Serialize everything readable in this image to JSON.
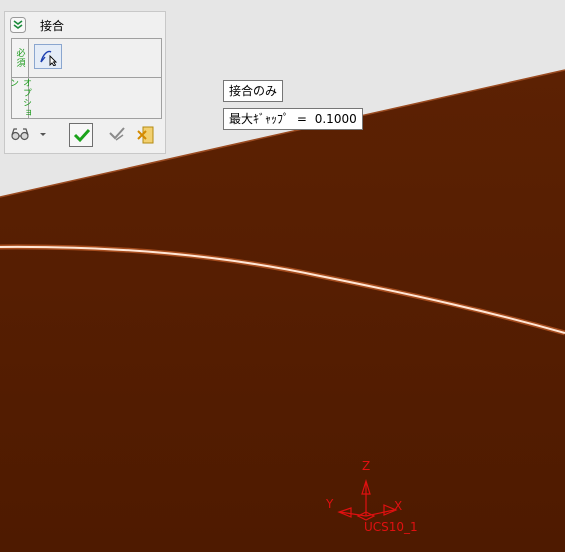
{
  "panel": {
    "title": "接合",
    "required_tab": "必須",
    "options_tab": "オプション"
  },
  "tooltips": {
    "join_only": "接合のみ",
    "max_gap_label": "最大ｷﾞｬｯﾌﾟ",
    "max_gap_equals": "=",
    "max_gap_value": "0.1000"
  },
  "triad": {
    "z_label": "Z",
    "x_label": "X",
    "y_label": "Y",
    "ucs_label": "UCS10_1"
  },
  "colors": {
    "background": "#e6e6e6",
    "surface": "#5a1f00",
    "highlight": "#ffffff",
    "triad": "#e01010",
    "check": "#1aa31a"
  }
}
